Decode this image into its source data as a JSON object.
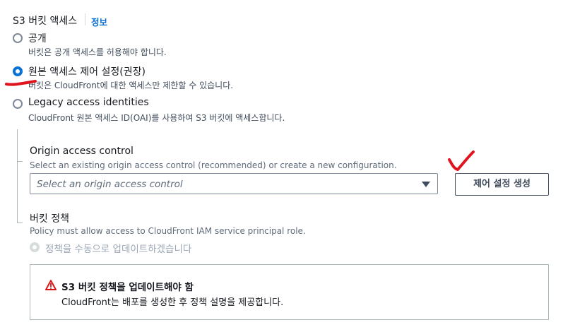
{
  "section": {
    "title": "S3 버킷 액세스",
    "info_link": "정보"
  },
  "options": [
    {
      "label": "공개",
      "desc": "버킷은 공개 액세스를 허용해야 합니다."
    },
    {
      "label": "원본 액세스 제어 설정(권장)",
      "desc": "버킷은 CloudFront에 대한 액세스만 제한할 수 있습니다."
    },
    {
      "label": "Legacy access identities",
      "desc": "CloudFront 원본 액세스 ID(OAI)를 사용하여 S3 버킷에 액세스합니다."
    }
  ],
  "selected_option": "원본 액세스 제어 설정(권장)",
  "oac": {
    "label": "Origin access control",
    "desc": "Select an existing origin access control (recommended) or create a new configuration.",
    "placeholder": "Select an origin access control",
    "create_button": "제어 설정 생성"
  },
  "bucket_policy": {
    "label": "버킷 정책",
    "desc": "Policy must allow access to CloudFront IAM service principal role.",
    "radio_label": "정책을 수동으로 업데이트하겠습니다"
  },
  "alert": {
    "title": "S3 버킷 정책을 업데이트해야 함",
    "body": "CloudFront는 배포를 생성한 후 정책 설명을 제공합니다."
  },
  "colors": {
    "accent": "#0972d3",
    "annotation": "#e0141e",
    "warning": "#d91515"
  },
  "icons": {
    "alert": "warning-triangle-icon",
    "select": "caret-down-icon"
  }
}
